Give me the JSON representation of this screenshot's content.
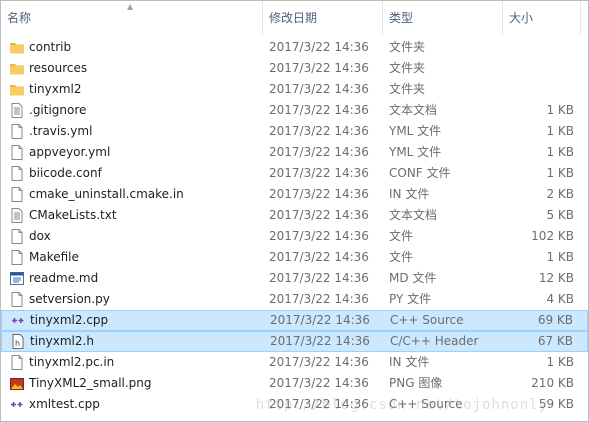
{
  "columns": {
    "name": "名称",
    "date": "修改日期",
    "type": "类型",
    "size": "大小"
  },
  "rows": [
    {
      "name": "contrib",
      "date": "2017/3/22 14:36",
      "type": "文件夹",
      "size": "",
      "icon": "folder-icon"
    },
    {
      "name": "resources",
      "date": "2017/3/22 14:36",
      "type": "文件夹",
      "size": "",
      "icon": "folder-icon"
    },
    {
      "name": "tinyxml2",
      "date": "2017/3/22 14:36",
      "type": "文件夹",
      "size": "",
      "icon": "folder-icon"
    },
    {
      "name": ".gitignore",
      "date": "2017/3/22 14:36",
      "type": "文本文档",
      "size": "1 KB",
      "icon": "text-file-icon"
    },
    {
      "name": ".travis.yml",
      "date": "2017/3/22 14:36",
      "type": "YML 文件",
      "size": "1 KB",
      "icon": "blank-file-icon"
    },
    {
      "name": "appveyor.yml",
      "date": "2017/3/22 14:36",
      "type": "YML 文件",
      "size": "1 KB",
      "icon": "blank-file-icon"
    },
    {
      "name": "biicode.conf",
      "date": "2017/3/22 14:36",
      "type": "CONF 文件",
      "size": "1 KB",
      "icon": "blank-file-icon"
    },
    {
      "name": "cmake_uninstall.cmake.in",
      "date": "2017/3/22 14:36",
      "type": "IN 文件",
      "size": "2 KB",
      "icon": "blank-file-icon"
    },
    {
      "name": "CMakeLists.txt",
      "date": "2017/3/22 14:36",
      "type": "文本文档",
      "size": "5 KB",
      "icon": "text-file-icon"
    },
    {
      "name": "dox",
      "date": "2017/3/22 14:36",
      "type": "文件",
      "size": "102 KB",
      "icon": "blank-file-icon"
    },
    {
      "name": "Makefile",
      "date": "2017/3/22 14:36",
      "type": "文件",
      "size": "1 KB",
      "icon": "blank-file-icon"
    },
    {
      "name": "readme.md",
      "date": "2017/3/22 14:36",
      "type": "MD 文件",
      "size": "12 KB",
      "icon": "markdown-file-icon"
    },
    {
      "name": "setversion.py",
      "date": "2017/3/22 14:36",
      "type": "PY 文件",
      "size": "4 KB",
      "icon": "blank-file-icon"
    },
    {
      "name": "tinyxml2.cpp",
      "date": "2017/3/22 14:36",
      "type": "C++ Source",
      "size": "69 KB",
      "icon": "cpp-file-icon",
      "state": "selected"
    },
    {
      "name": "tinyxml2.h",
      "date": "2017/3/22 14:36",
      "type": "C/C++ Header",
      "size": "67 KB",
      "icon": "header-file-icon",
      "state": "selected"
    },
    {
      "name": "tinyxml2.pc.in",
      "date": "2017/3/22 14:36",
      "type": "IN 文件",
      "size": "1 KB",
      "icon": "blank-file-icon"
    },
    {
      "name": "TinyXML2_small.png",
      "date": "2017/3/22 14:36",
      "type": "PNG 图像",
      "size": "210 KB",
      "icon": "image-file-icon"
    },
    {
      "name": "xmltest.cpp",
      "date": "2017/3/22 14:36",
      "type": "C++ Source",
      "size": "59 KB",
      "icon": "cpp-file-icon"
    }
  ],
  "watermark": "http://blog.csdn.net/tojohnonly",
  "colors": {
    "selection_bg": "#cce8ff",
    "selection_border": "#99d1ff",
    "header_text": "#4c607a",
    "folder": "#e8b84a"
  }
}
